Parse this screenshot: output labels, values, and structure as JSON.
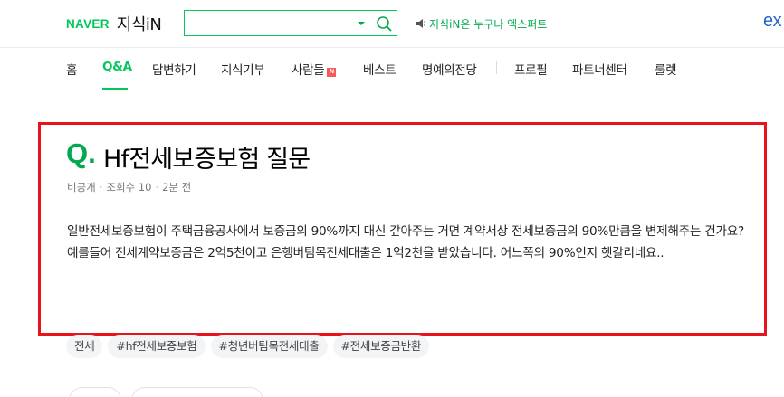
{
  "header": {
    "logo_naver": "NAVER",
    "logo_service": "지식iN",
    "search": {
      "value": "",
      "placeholder": ""
    },
    "notice": "지식iN은 누구나 엑스퍼트",
    "expert_logo": "ex"
  },
  "nav": {
    "items": [
      {
        "label": "홈"
      },
      {
        "label": "Q&A",
        "active": true
      },
      {
        "label": "답변하기"
      },
      {
        "label": "지식기부"
      },
      {
        "label": "사람들",
        "badge": "N"
      },
      {
        "label": "베스트"
      },
      {
        "label": "명예의전당"
      },
      {
        "label": "프로필"
      },
      {
        "label": "파트너센터"
      },
      {
        "label": "룰렛"
      }
    ]
  },
  "question": {
    "q_mark": "Q.",
    "title": "Hf전세보증보험 질문",
    "meta": {
      "author": "비공개",
      "views": "조회수 10",
      "time": "2분 전"
    },
    "body": [
      "일반전세보증보험이 주택금융공사에서 보증금의 90%까지 대신 갚아주는 거면 계약서상 전세보증금의 90%만큼을 변제해주는 건가요?",
      "예를들어 전세계약보증금은 2억5천이고 은행버팀목전세대출은 1억2천을 받았습니다. 어느쪽의 90%인지 헷갈리네요.."
    ],
    "tags": [
      "전세",
      "#hf전세보증보험",
      "#청년버팀목전세대출",
      "#전세보증금반환"
    ]
  },
  "colors": {
    "brand_green": "#03c75a",
    "highlight_red": "#e8141c",
    "expert_blue": "#2b62c9",
    "badge_red": "#f35c5c"
  }
}
